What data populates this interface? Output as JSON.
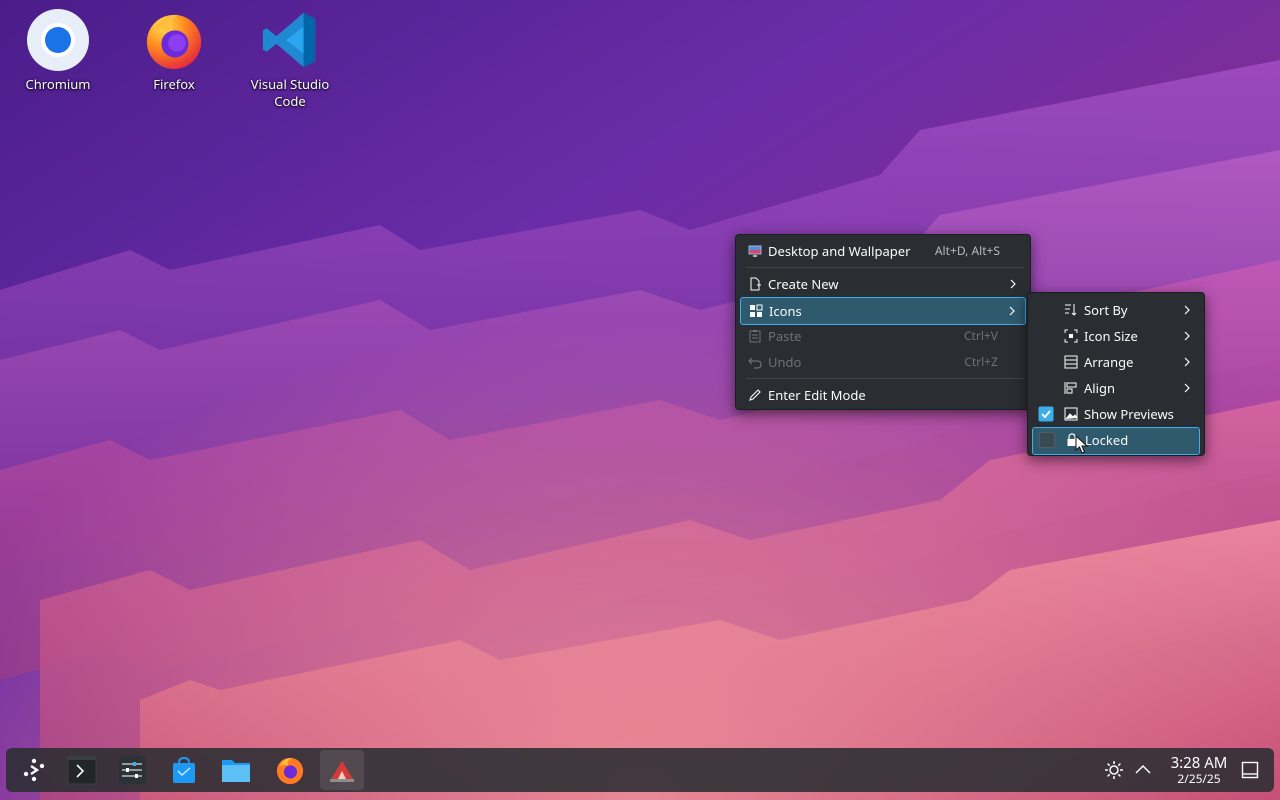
{
  "desktop": {
    "icons": [
      {
        "label": "Chromium",
        "icon": "chromium-icon"
      },
      {
        "label": "Firefox",
        "icon": "firefox-icon"
      },
      {
        "label": "Visual Studio Code",
        "icon": "vscode-icon"
      }
    ]
  },
  "context_menu": {
    "items": [
      {
        "label": "Desktop and Wallpaper",
        "shortcut": "Alt+D, Alt+S",
        "icon": "desktop-wallpaper-icon",
        "enabled": true
      },
      {
        "label": "Create New",
        "icon": "create-new-icon",
        "submenu": true,
        "enabled": true
      },
      {
        "label": "Icons",
        "icon": "icons-grid-icon",
        "submenu": true,
        "enabled": true,
        "highlighted": true
      },
      {
        "label": "Paste",
        "shortcut": "Ctrl+V",
        "icon": "paste-icon",
        "enabled": false
      },
      {
        "label": "Undo",
        "shortcut": "Ctrl+Z",
        "icon": "undo-icon",
        "enabled": false
      },
      {
        "label": "Enter Edit Mode",
        "icon": "edit-pencil-icon",
        "enabled": true
      }
    ]
  },
  "icons_submenu": {
    "items": [
      {
        "label": "Sort By",
        "icon": "sort-icon",
        "submenu": true
      },
      {
        "label": "Icon Size",
        "icon": "icon-size-icon",
        "submenu": true
      },
      {
        "label": "Arrange",
        "icon": "arrange-icon",
        "submenu": true
      },
      {
        "label": "Align",
        "icon": "align-icon",
        "submenu": true
      },
      {
        "label": "Show Previews",
        "icon": "image-icon",
        "checked": true
      },
      {
        "label": "Locked",
        "icon": "lock-icon",
        "checked": false,
        "highlighted": true
      }
    ]
  },
  "taskbar": {
    "items": [
      {
        "name": "application-launcher",
        "icon": "kde-launcher-icon"
      },
      {
        "name": "konsole",
        "icon": "terminal-icon"
      },
      {
        "name": "system-settings",
        "icon": "settings-sliders-icon"
      },
      {
        "name": "discover",
        "icon": "store-bag-icon"
      },
      {
        "name": "dolphin",
        "icon": "folder-icon"
      },
      {
        "name": "firefox",
        "icon": "firefox-icon"
      },
      {
        "name": "app",
        "icon": "app-icon",
        "active": true
      }
    ],
    "tray": {
      "brightness_icon": "brightness-icon",
      "expand_icon": "chevron-up-icon",
      "show_desktop_icon": "show-desktop-icon"
    },
    "clock": {
      "time": "3:28 AM",
      "date": "2/25/25"
    }
  },
  "colors": {
    "menu_bg": "#2a2e32",
    "highlight": "#2f5a6e",
    "accent": "#3daee9"
  }
}
